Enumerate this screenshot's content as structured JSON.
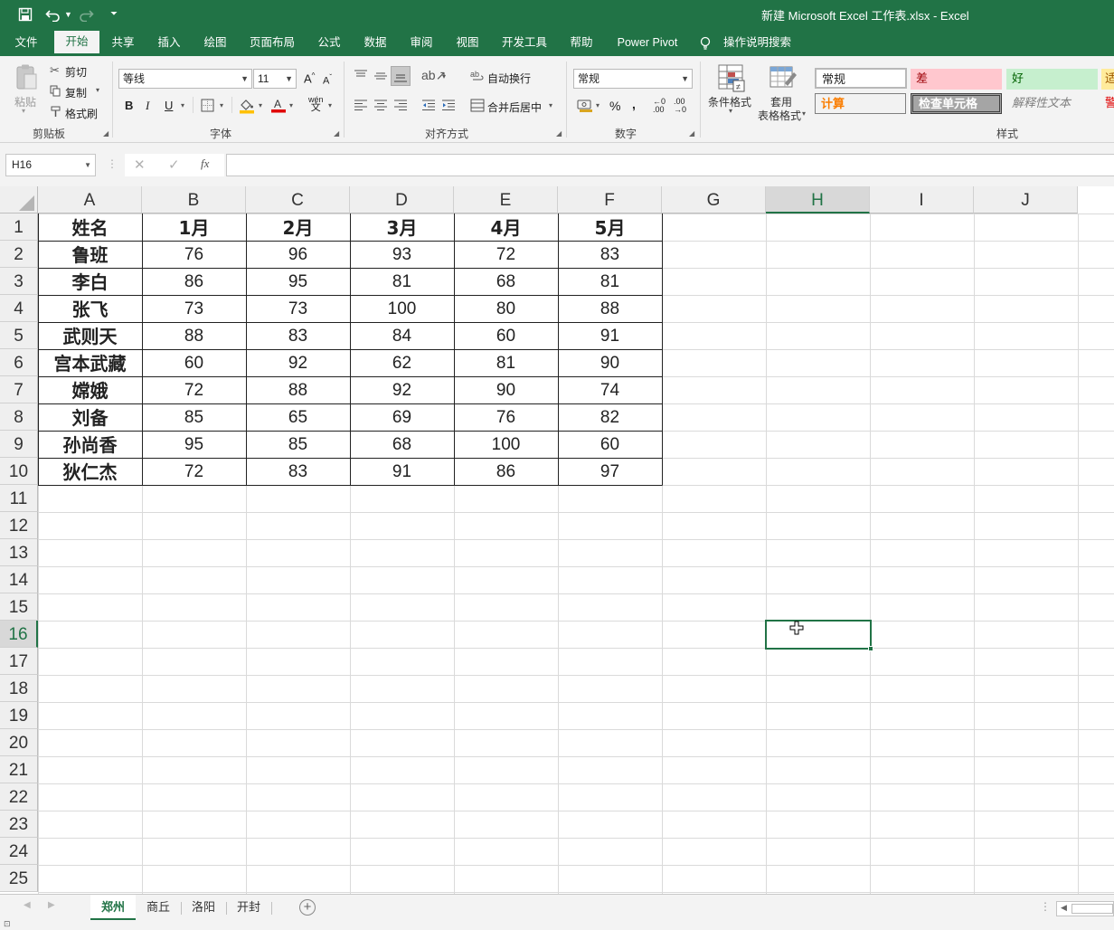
{
  "app": {
    "title": "新建 Microsoft Excel 工作表.xlsx  -  Excel"
  },
  "quick_access": {
    "save_icon": "save-icon",
    "undo_icon": "undo-icon",
    "redo_icon": "redo-icon",
    "customize_icon": "chevron-down-icon"
  },
  "menu_tabs": [
    "文件",
    "开始",
    "共享",
    "插入",
    "绘图",
    "页面布局",
    "公式",
    "数据",
    "审阅",
    "视图",
    "开发工具",
    "帮助",
    "Power Pivot",
    "操作说明搜索"
  ],
  "active_menu_tab": "开始",
  "ribbon": {
    "clipboard": {
      "paste": "粘贴",
      "cut": "剪切",
      "copy": "复制",
      "format_painter": "格式刷",
      "label": "剪贴板"
    },
    "font": {
      "font_name": "等线",
      "font_size": "11",
      "bold": "B",
      "italic": "I",
      "underline": "U",
      "label": "字体"
    },
    "alignment": {
      "wrap_text": "自动换行",
      "merge_center": "合并后居中",
      "label": "对齐方式"
    },
    "number": {
      "format": "常规",
      "percent": "%",
      "comma": ",",
      "label": "数字"
    },
    "conditional_format": "条件格式",
    "table_format_line1": "套用",
    "table_format_line2": "表格格式",
    "styles": {
      "label": "样式",
      "normal": "常规",
      "bad": "差",
      "good": "好",
      "neutral": "适",
      "calculation": "计算",
      "check_cell": "检查单元格",
      "explanatory": "解释性文本",
      "warning": "警"
    }
  },
  "formula_bar": {
    "name_box": "H16",
    "cancel": "✕",
    "enter": "✓",
    "fx": "fx",
    "value": ""
  },
  "grid": {
    "columns": [
      "A",
      "B",
      "C",
      "D",
      "E",
      "F",
      "G",
      "H",
      "I",
      "J"
    ],
    "rows": [
      "1",
      "2",
      "3",
      "4",
      "5",
      "6",
      "7",
      "8",
      "9",
      "10",
      "11",
      "12",
      "13",
      "14",
      "15",
      "16",
      "17",
      "18",
      "19",
      "20",
      "21",
      "22",
      "23",
      "24",
      "25"
    ],
    "selected_cell": "H16",
    "selected_column": "H",
    "selected_row": "16",
    "header": [
      "姓名",
      "1月",
      "2月",
      "3月",
      "4月",
      "5月"
    ],
    "data": [
      [
        "鲁班",
        "76",
        "96",
        "93",
        "72",
        "83"
      ],
      [
        "李白",
        "86",
        "95",
        "81",
        "68",
        "81"
      ],
      [
        "张飞",
        "73",
        "73",
        "100",
        "80",
        "88"
      ],
      [
        "武则天",
        "88",
        "83",
        "84",
        "60",
        "91"
      ],
      [
        "宫本武藏",
        "60",
        "92",
        "62",
        "81",
        "90"
      ],
      [
        "嫦娥",
        "72",
        "88",
        "92",
        "90",
        "74"
      ],
      [
        "刘备",
        "85",
        "65",
        "69",
        "76",
        "82"
      ],
      [
        "孙尚香",
        "95",
        "85",
        "68",
        "100",
        "60"
      ],
      [
        "狄仁杰",
        "72",
        "83",
        "91",
        "86",
        "97"
      ]
    ]
  },
  "sheet_tabs": [
    "郑州",
    "商丘",
    "洛阳",
    "开封"
  ],
  "active_sheet": "郑州",
  "colors": {
    "accent": "#217346",
    "ribbon_bg": "#f3f3f3",
    "bad_bg": "#ffc7ce",
    "bad_fg": "#9c0006",
    "good_bg": "#c6efce",
    "good_fg": "#006100",
    "neutral_bg": "#ffeb9c",
    "calc_fg": "#fa7d00",
    "check_bg": "#a5a5a5"
  }
}
